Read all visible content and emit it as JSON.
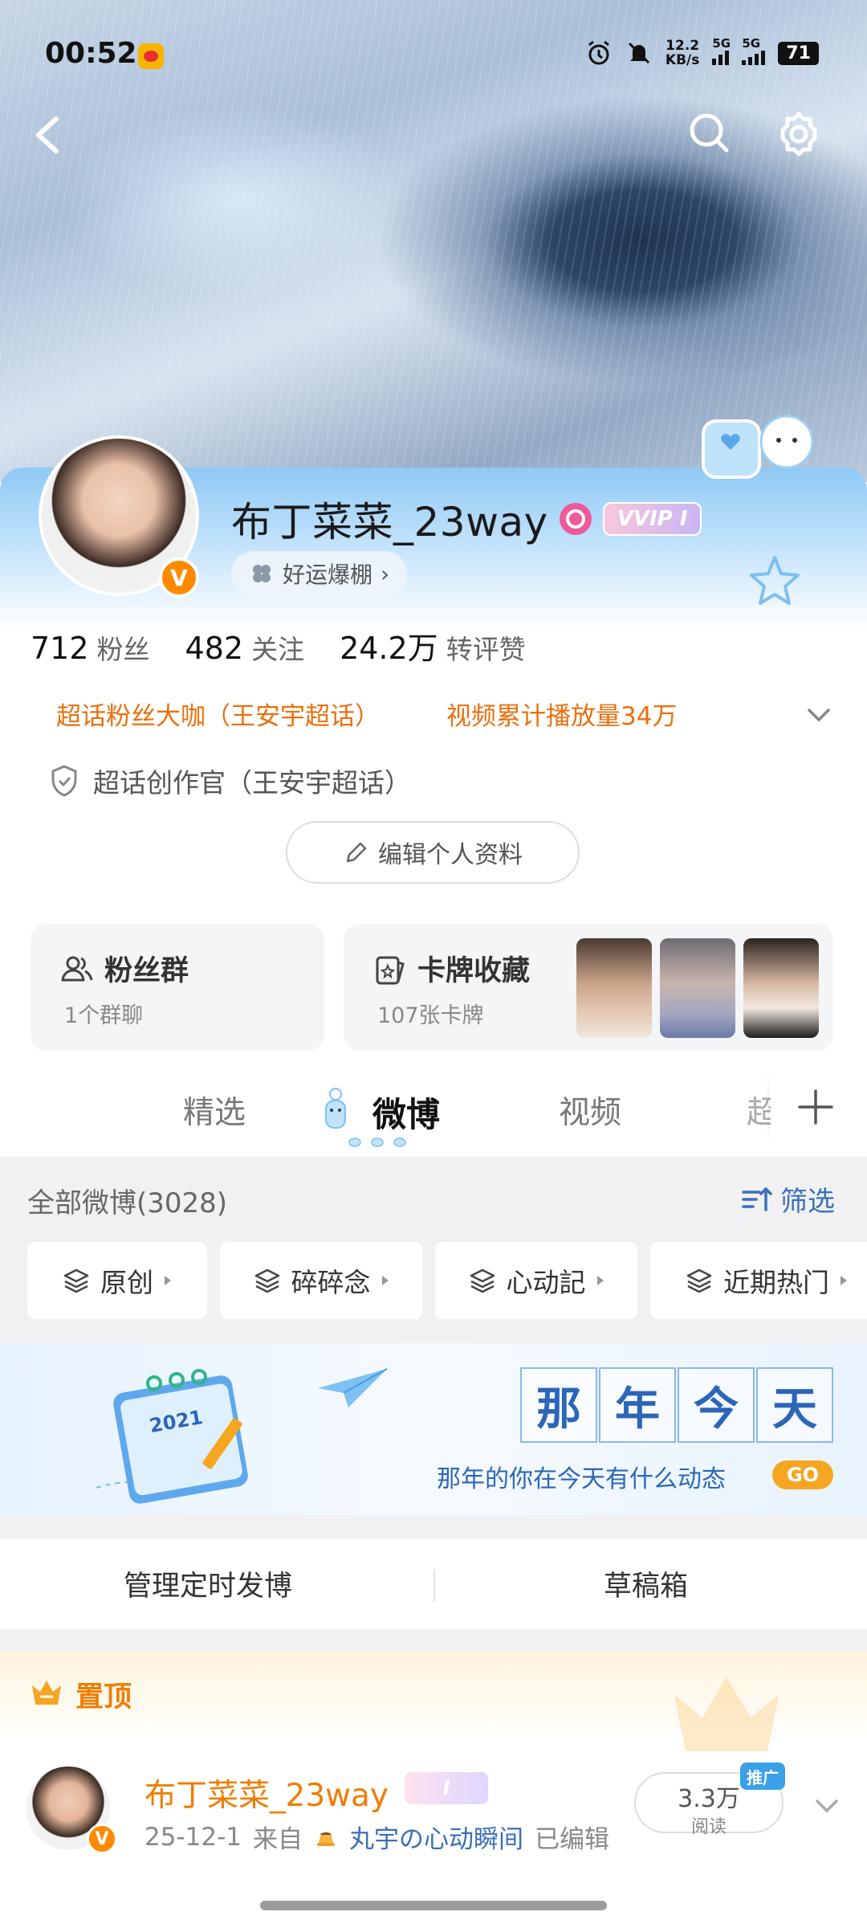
{
  "status_bar": {
    "time": "00:52",
    "net_speed_value": "12.2",
    "net_speed_unit": "KB/s",
    "sim1": "5G",
    "sim2": "5G",
    "battery": "71"
  },
  "profile": {
    "username": "布丁菜菜_23way",
    "vip_label": "VVIP I",
    "luck_label": "好运爆棚",
    "stats": [
      {
        "value": "712",
        "label": "粉丝"
      },
      {
        "value": "482",
        "label": "关注"
      },
      {
        "value": "24.2万",
        "label": "转评赞"
      }
    ],
    "honors": [
      "超话粉丝大咖（王安宇超话）",
      "视频累计播放量34万"
    ],
    "creator_title": "超话创作官（王安宇超话）",
    "edit_label": "编辑个人资料"
  },
  "cards": {
    "fans_group": {
      "title": "粉丝群",
      "sub": "1个群聊"
    },
    "card_collection": {
      "title": "卡牌收藏",
      "sub": "107张卡牌"
    }
  },
  "tabs": [
    {
      "label": "精选"
    },
    {
      "label": "微博"
    },
    {
      "label": "视频"
    },
    {
      "label": "超话"
    }
  ],
  "feed": {
    "all_count_label": "全部微博(3028)",
    "filter_label": "筛选",
    "chips": [
      "原创",
      "碎碎念",
      "心动記",
      "近期热门"
    ]
  },
  "banner": {
    "title_chars": [
      "那",
      "年",
      "今",
      "天"
    ],
    "subtitle": "那年的你在今天有什么动态",
    "go": "GO",
    "calendar_year": "2021"
  },
  "manage": {
    "scheduled": "管理定时发博",
    "drafts": "草稿箱"
  },
  "pinned": {
    "label": "置顶",
    "author": "布丁菜菜_23way",
    "date": "25-12-1",
    "from": "来自",
    "source": "丸宇の心动瞬间",
    "edited": "已编辑",
    "reads_value": "3.3万",
    "reads_label": "阅读",
    "promo": "推广"
  },
  "colors": {
    "accent_orange": "#f07d00",
    "honor_orange": "#e9700e",
    "link_blue": "#3a6fb8",
    "vip_orange": "#ff8a00"
  }
}
